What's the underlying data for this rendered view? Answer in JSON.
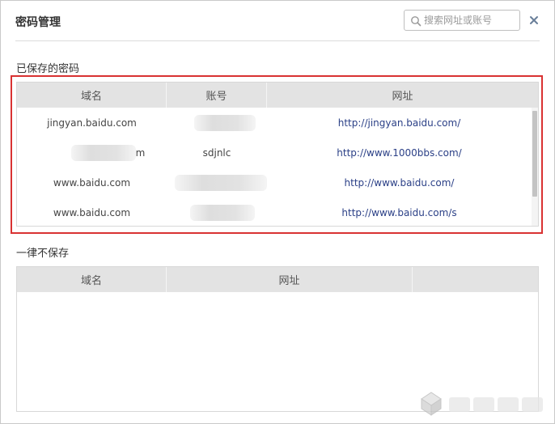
{
  "dialog": {
    "title": "密码管理",
    "search_placeholder": "搜索网址或账号",
    "search_value": ""
  },
  "saved": {
    "label": "已保存的密码",
    "columns": [
      "域名",
      "账号",
      "网址"
    ],
    "rows": [
      {
        "domain": "jingyan.baidu.com",
        "account": "",
        "url": "http://jingyan.baidu.com/"
      },
      {
        "domain": "m",
        "account": "sdjnlc",
        "url": "http://www.1000bbs.com/"
      },
      {
        "domain": "www.baidu.com",
        "account": "",
        "url": "http://www.baidu.com/"
      },
      {
        "domain": "www.baidu.com",
        "account": "",
        "url": "http://www.baidu.com/s"
      }
    ]
  },
  "never": {
    "label": "一律不保存",
    "columns": [
      "域名",
      "网址"
    ],
    "rows": []
  },
  "colors": {
    "highlight_border": "#d93232",
    "header_bg": "#e3e3e3",
    "url_text": "#2a3f86"
  },
  "icons": {
    "search": "search-icon",
    "close": "close-icon",
    "watermark": "site-logo"
  }
}
